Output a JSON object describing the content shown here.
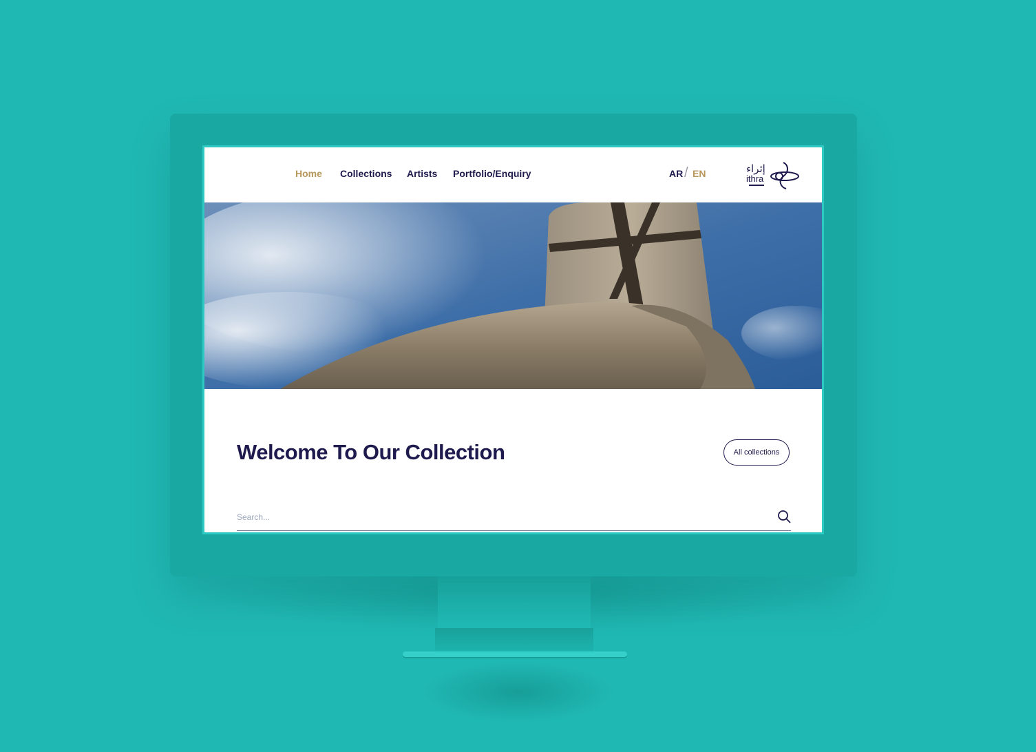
{
  "colors": {
    "background": "#20b8b3",
    "navy": "#1e1a4d",
    "gold": "#b8975a"
  },
  "nav": {
    "items": [
      {
        "label": "Home",
        "active": true
      },
      {
        "label": "Collections",
        "active": false
      },
      {
        "label": "Artists",
        "active": false
      },
      {
        "label": "Portfolio/Enquiry",
        "active": false
      }
    ]
  },
  "language": {
    "ar": "AR",
    "separator": "/",
    "en": "EN"
  },
  "logo": {
    "arabic": "إثراء",
    "latin": "ithra",
    "icon": "ithra-logo-icon"
  },
  "main": {
    "title": "Welcome To Our Collection",
    "all_collections_label": "All collections"
  },
  "search": {
    "placeholder": "Search...",
    "value": "",
    "icon": "search-icon"
  }
}
